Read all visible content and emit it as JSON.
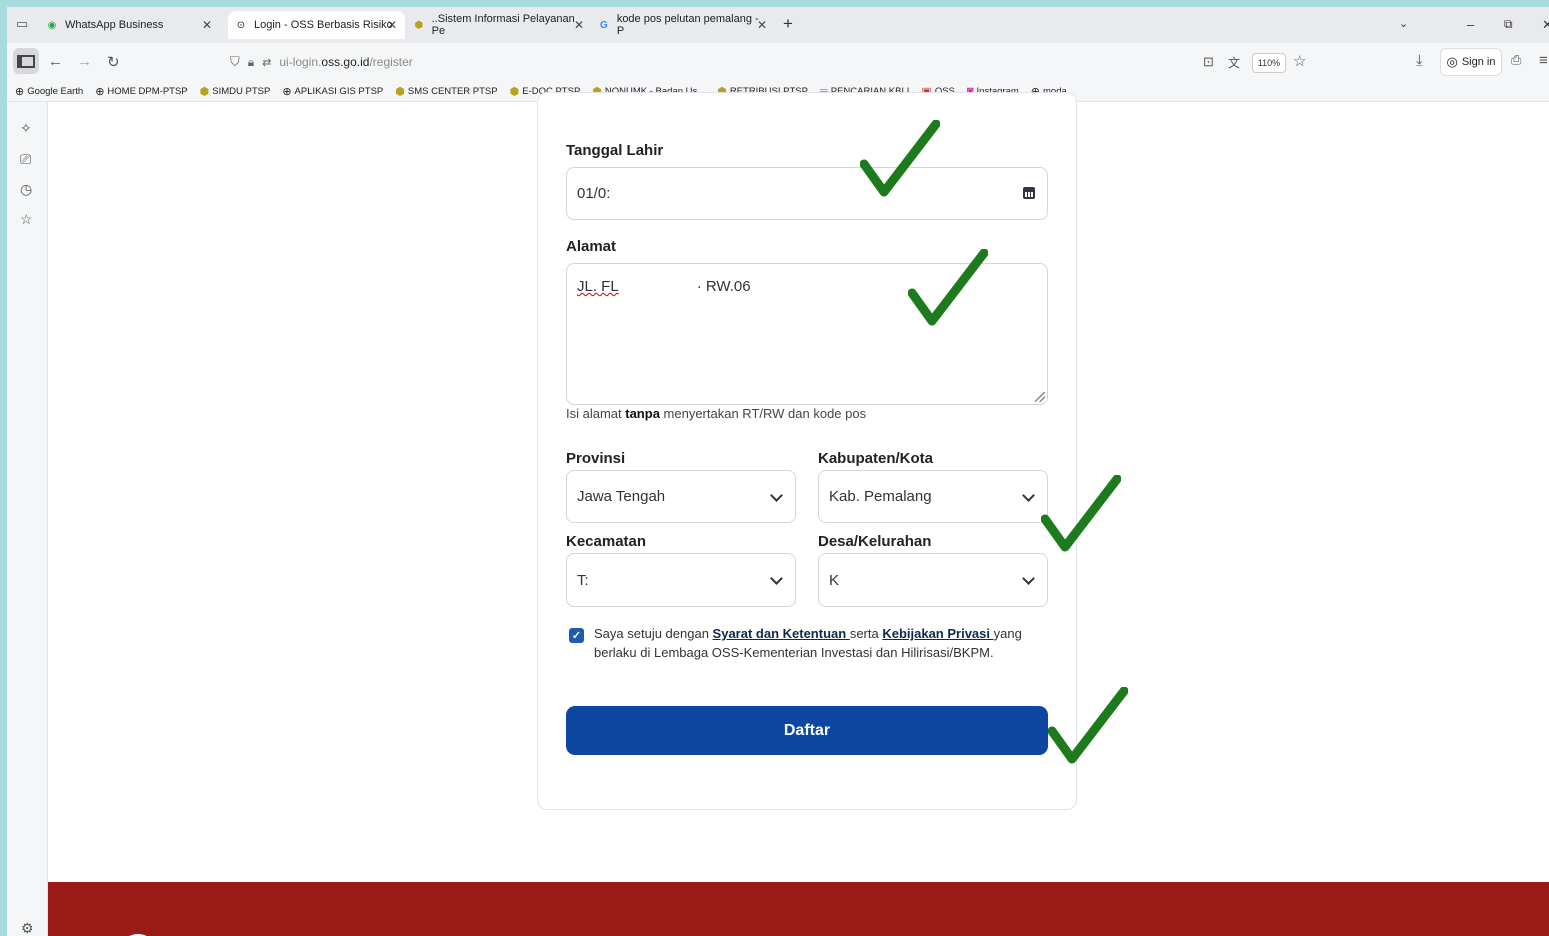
{
  "tabs": [
    {
      "title": "WhatsApp Business",
      "icon": "whatsapp-icon"
    },
    {
      "title": "Login - OSS Berbasis Risiko",
      "icon": "globe-icon"
    },
    {
      "title": "..Sistem Informasi Pelayanan Pe",
      "icon": "emblem-icon"
    },
    {
      "title": "kode pos pelutan pemalang - P",
      "icon": "google-icon"
    }
  ],
  "address": {
    "prefix": "ui-login.",
    "domain": "oss.go.id",
    "path": "/register",
    "zoom": "110%",
    "sign_in": "Sign in"
  },
  "bookmarks": [
    {
      "label": "Google Earth",
      "icon": "globe-icon"
    },
    {
      "label": "HOME DPM-PTSP",
      "icon": "globe-icon"
    },
    {
      "label": "SIMDU PTSP",
      "icon": "emblem-icon"
    },
    {
      "label": "APLIKASI GIS PTSP",
      "icon": "globe-icon"
    },
    {
      "label": "SMS CENTER PTSP",
      "icon": "emblem-icon"
    },
    {
      "label": "E-DOC PTSP",
      "icon": "emblem-icon"
    },
    {
      "label": "NONUMK - Badan Us...",
      "icon": "emblem-icon"
    },
    {
      "label": "RETRIBUSI PTSP",
      "icon": "emblem-icon"
    },
    {
      "label": "PENCARIAN KBLI",
      "icon": "dash-icon"
    },
    {
      "label": "OSS",
      "icon": "oss-icon"
    },
    {
      "label": "Instagram",
      "icon": "instagram-icon"
    },
    {
      "label": "moda",
      "icon": "globe-icon"
    }
  ],
  "form": {
    "tanggal_lahir": {
      "label": "Tanggal Lahir",
      "value": "01/0:"
    },
    "alamat": {
      "label": "Alamat",
      "value_part1": "JL. FL",
      "value_part2": "· RW.06",
      "help_pre": "Isi alamat ",
      "help_bold": "tanpa",
      "help_post": " menyertakan RT/RW dan kode pos"
    },
    "provinsi": {
      "label": "Provinsi",
      "value": "Jawa Tengah"
    },
    "kabupaten": {
      "label": "Kabupaten/Kota",
      "value": "Kab. Pemalang"
    },
    "kecamatan": {
      "label": "Kecamatan",
      "value": "T:"
    },
    "desa": {
      "label": "Desa/Kelurahan",
      "value": "K"
    },
    "agree": {
      "checked": true,
      "pre": "Saya setuju dengan ",
      "link1": "Syarat dan Ketentuan ",
      "mid": "serta ",
      "link2": "Kebijakan Privasi ",
      "post": "yang",
      "line2": "berlaku di Lembaga OSS-Kementerian Investasi dan Hilirisasi/BKPM."
    },
    "submit": "Daftar"
  },
  "colors": {
    "primary": "#0d47a1",
    "footer": "#9b1c16",
    "check": "#1d7a1d"
  }
}
